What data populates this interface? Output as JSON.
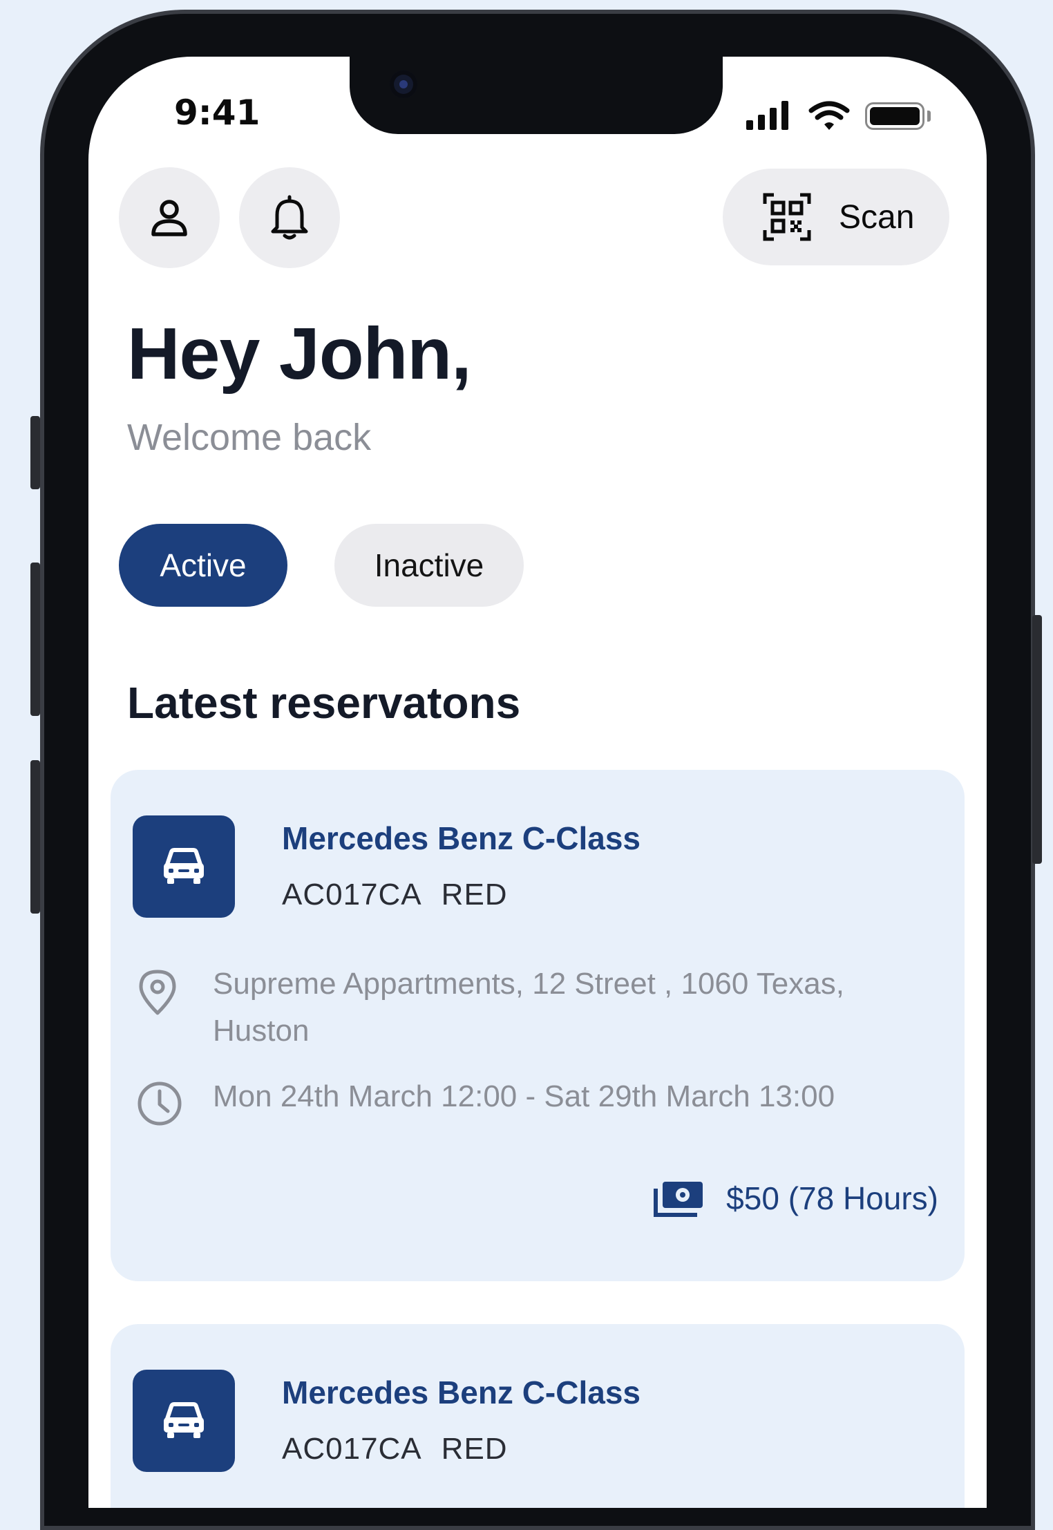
{
  "status_bar": {
    "time": "9:41"
  },
  "header": {
    "profile_icon": "person-icon",
    "notifications_icon": "bell-icon",
    "scan_icon": "qr-code-icon",
    "scan_label": "Scan"
  },
  "greeting": {
    "title": "Hey John,",
    "subtitle": "Welcome back"
  },
  "filters": {
    "tabs": [
      {
        "label": "Active",
        "selected": true
      },
      {
        "label": "Inactive",
        "selected": false
      }
    ]
  },
  "reservations": {
    "title": "Latest reservatons",
    "items": [
      {
        "car_name": "Mercedes Benz C-Class",
        "plate": "AC017CA",
        "color": "RED",
        "address": "Supreme Appartments, 12 Street , 1060 Texas, Huston",
        "period": "Mon 24th March 12:00 - Sat 29th March 13:00",
        "price": "$50 (78 Hours)"
      },
      {
        "car_name": "Mercedes Benz C-Class",
        "plate": "AC017CA",
        "color": "RED"
      }
    ]
  },
  "colors": {
    "accent": "#1c3f7d",
    "card_background": "#e8f0fa",
    "muted_text": "#8b8e96"
  }
}
